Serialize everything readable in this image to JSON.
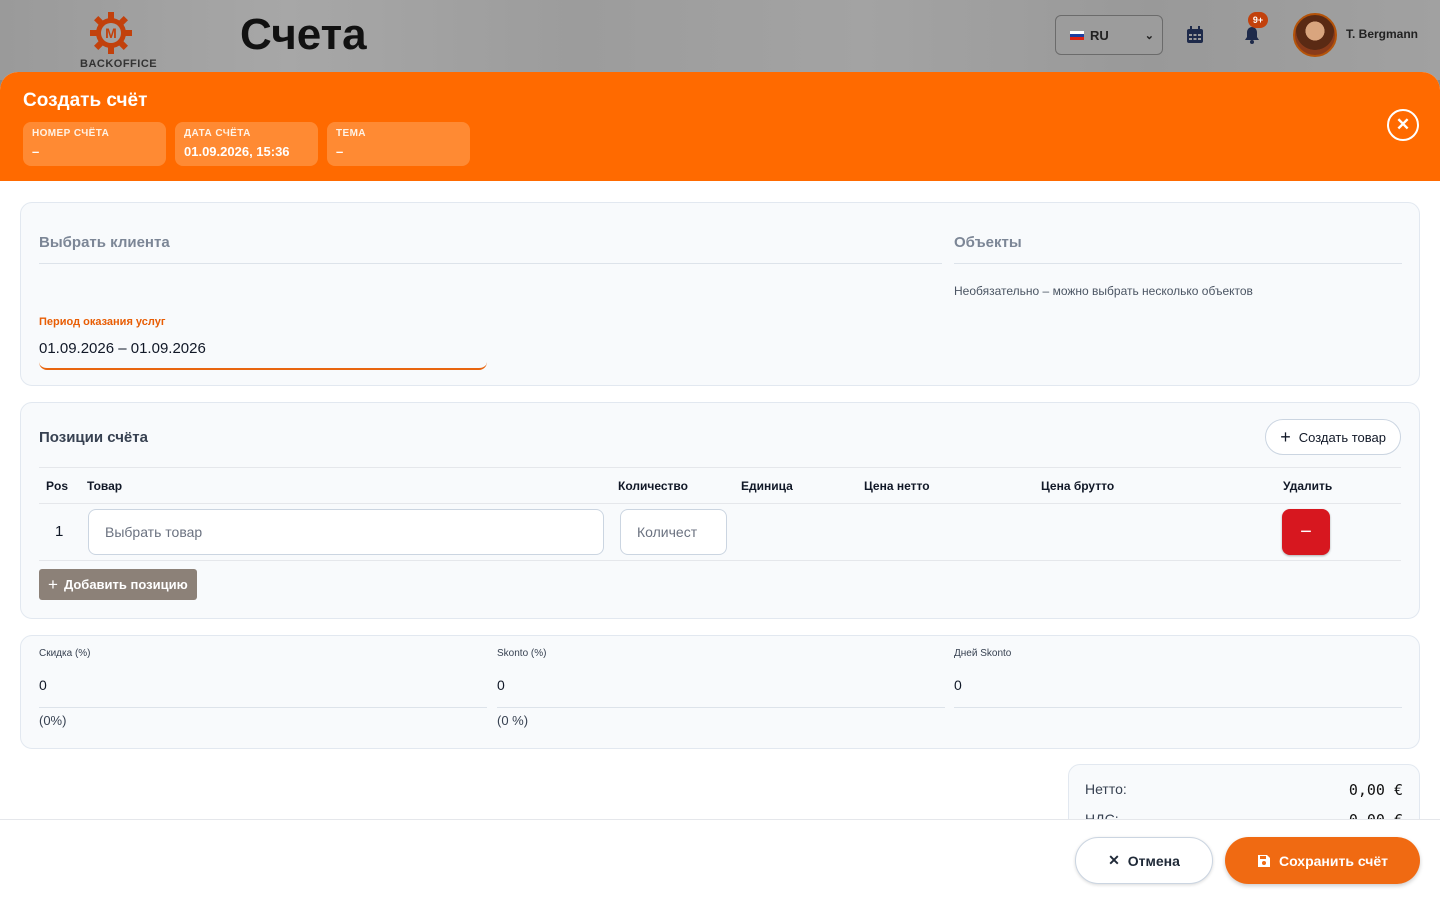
{
  "app": {
    "logo_text": "BACKOFFICE",
    "page_title": "Счета",
    "language": "RU",
    "notifications_badge": "9+",
    "user_name": "T. Bergmann"
  },
  "modal": {
    "title": "Создать счёт",
    "meta": [
      {
        "label": "НОМЕР СЧЁТА",
        "value": "–"
      },
      {
        "label": "ДАТА СЧЁТА",
        "value": "01.09.2026, 15:36"
      },
      {
        "label": "ТЕМА",
        "value": "–"
      }
    ],
    "client_placeholder": "Выбрать клиента",
    "objects_placeholder": "Объекты",
    "objects_hint": "Необязательно – можно выбрать несколько объектов",
    "period_label": "Период оказания услуг",
    "period_value": "01.09.2026 – 01.09.2026"
  },
  "positions": {
    "title": "Позиции счёта",
    "create_product": "Создать товар",
    "columns": [
      "Pos",
      "Товар",
      "Количество",
      "Единица",
      "Цена нетто",
      "Цена брутто",
      "Удалить"
    ],
    "rows": [
      {
        "pos": "1",
        "product_placeholder": "Выбрать товар",
        "qty_placeholder": "Количест"
      }
    ],
    "add_position": "Добавить позицию"
  },
  "discounts": {
    "discount_label": "Скидка (%)",
    "discount_value": "0",
    "discount_sub": "(0%)",
    "skonto_label": "Skonto (%)",
    "skonto_value": "0",
    "skonto_sub": "(0 %)",
    "skonto_days_label": "Дней Skonto",
    "skonto_days_value": "0"
  },
  "totals": {
    "net_label": "Нетто:",
    "net_value": "0,00 €",
    "vat_label": "НДС:",
    "vat_value": "0,00 €"
  },
  "footer": {
    "cancel": "Отмена",
    "save": "Сохранить счёт"
  },
  "colors": {
    "accent": "#ff6a00",
    "danger": "#d7171f",
    "secondary": "#8c8178"
  }
}
